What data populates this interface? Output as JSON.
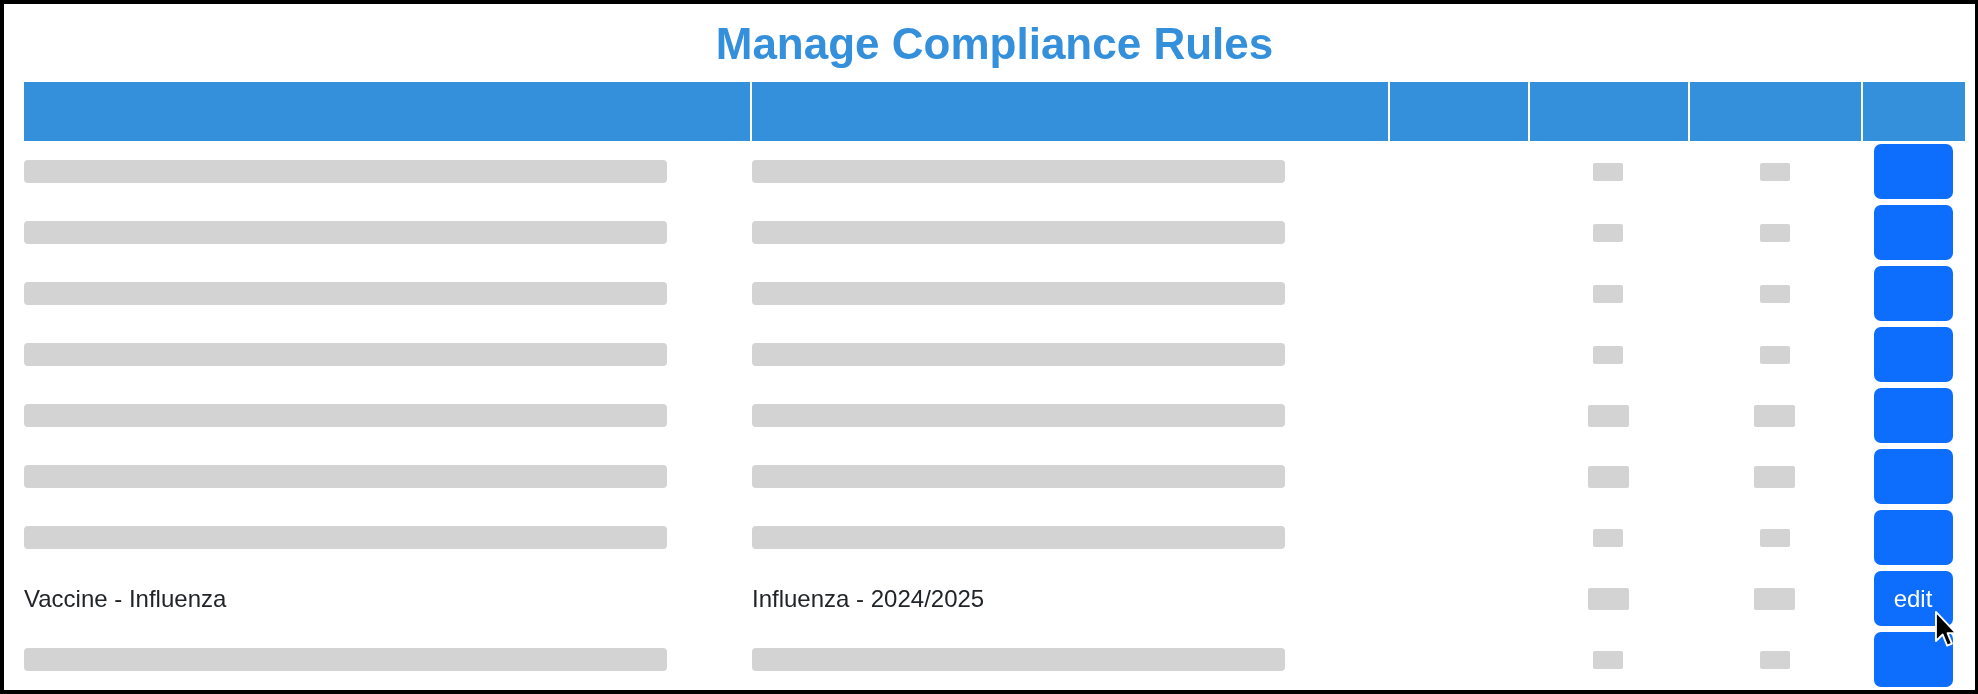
{
  "title": "Manage Compliance Rules",
  "table": {
    "rows": [
      {
        "cells": [
          {
            "kind": "bar"
          },
          {
            "kind": "bar"
          },
          {
            "kind": "bar"
          },
          {
            "kind": "bar"
          }
        ],
        "button": {
          "hovered": false
        }
      },
      {
        "cells": [
          {
            "kind": "bar"
          },
          {
            "kind": "bar"
          },
          {
            "kind": "bar"
          },
          {
            "kind": "bar"
          }
        ],
        "button": {
          "hovered": false
        }
      },
      {
        "cells": [
          {
            "kind": "bar"
          },
          {
            "kind": "bar"
          },
          {
            "kind": "bar"
          },
          {
            "kind": "bar"
          }
        ],
        "button": {
          "hovered": false
        }
      },
      {
        "cells": [
          {
            "kind": "bar"
          },
          {
            "kind": "bar"
          },
          {
            "kind": "bar"
          },
          {
            "kind": "bar"
          }
        ],
        "button": {
          "hovered": false
        }
      },
      {
        "cells": [
          {
            "kind": "bar"
          },
          {
            "kind": "bar"
          },
          {
            "kind": "widebar"
          },
          {
            "kind": "widebar"
          }
        ],
        "button": {
          "hovered": false
        }
      },
      {
        "cells": [
          {
            "kind": "bar"
          },
          {
            "kind": "bar"
          },
          {
            "kind": "widebar"
          },
          {
            "kind": "widebar"
          }
        ],
        "button": {
          "hovered": false
        }
      },
      {
        "cells": [
          {
            "kind": "bar"
          },
          {
            "kind": "bar"
          },
          {
            "kind": "bar"
          },
          {
            "kind": "bar"
          }
        ],
        "button": {
          "hovered": false
        }
      },
      {
        "cells": [
          {
            "kind": "text",
            "text": "Vaccine - Influenza"
          },
          {
            "kind": "text",
            "text": "Influenza - 2024/2025"
          },
          {
            "kind": "widebar"
          },
          {
            "kind": "widebar"
          }
        ],
        "button": {
          "label": "edit",
          "hovered": true
        }
      },
      {
        "cells": [
          {
            "kind": "bar"
          },
          {
            "kind": "bar"
          },
          {
            "kind": "bar"
          },
          {
            "kind": "bar"
          }
        ],
        "button": {
          "hovered": false
        }
      }
    ]
  }
}
